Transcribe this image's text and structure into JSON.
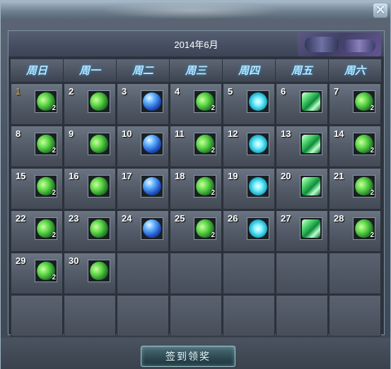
{
  "window": {
    "title": "",
    "close_glyph": "✕"
  },
  "calendar": {
    "month_title": "2014年6月",
    "weekdays": [
      "周日",
      "周一",
      "周二",
      "周三",
      "周四",
      "周五",
      "周六"
    ],
    "today": 1,
    "days": [
      {
        "day": 1,
        "item": "green-leaf-gem",
        "qty": "2"
      },
      {
        "day": 2,
        "item": "green-leaf-gem",
        "qty": ""
      },
      {
        "day": 3,
        "item": "blue-orb",
        "qty": ""
      },
      {
        "day": 4,
        "item": "green-leaf-gem",
        "qty": "2"
      },
      {
        "day": 5,
        "item": "cyan-orb",
        "qty": ""
      },
      {
        "day": 6,
        "item": "green-crystal",
        "qty": ""
      },
      {
        "day": 7,
        "item": "green-leaf-gem",
        "qty": "2"
      },
      {
        "day": 8,
        "item": "green-leaf-gem",
        "qty": "2"
      },
      {
        "day": 9,
        "item": "green-leaf-gem",
        "qty": ""
      },
      {
        "day": 10,
        "item": "blue-orb",
        "qty": ""
      },
      {
        "day": 11,
        "item": "green-leaf-gem",
        "qty": "2"
      },
      {
        "day": 12,
        "item": "cyan-orb",
        "qty": ""
      },
      {
        "day": 13,
        "item": "green-crystal",
        "qty": ""
      },
      {
        "day": 14,
        "item": "green-leaf-gem",
        "qty": "2"
      },
      {
        "day": 15,
        "item": "green-leaf-gem",
        "qty": "2"
      },
      {
        "day": 16,
        "item": "green-leaf-gem",
        "qty": ""
      },
      {
        "day": 17,
        "item": "blue-orb",
        "qty": ""
      },
      {
        "day": 18,
        "item": "green-leaf-gem",
        "qty": "2"
      },
      {
        "day": 19,
        "item": "cyan-orb",
        "qty": ""
      },
      {
        "day": 20,
        "item": "green-crystal",
        "qty": ""
      },
      {
        "day": 21,
        "item": "green-leaf-gem",
        "qty": "2"
      },
      {
        "day": 22,
        "item": "green-leaf-gem",
        "qty": "2"
      },
      {
        "day": 23,
        "item": "green-leaf-gem",
        "qty": ""
      },
      {
        "day": 24,
        "item": "blue-orb",
        "qty": ""
      },
      {
        "day": 25,
        "item": "green-leaf-gem",
        "qty": "2"
      },
      {
        "day": 26,
        "item": "cyan-orb",
        "qty": ""
      },
      {
        "day": 27,
        "item": "green-crystal",
        "qty": ""
      },
      {
        "day": 28,
        "item": "green-leaf-gem",
        "qty": "2"
      },
      {
        "day": 29,
        "item": "green-leaf-gem",
        "qty": "2"
      },
      {
        "day": 30,
        "item": "green-leaf-gem",
        "qty": ""
      }
    ],
    "total_cells": 42
  },
  "footer": {
    "signin_button_label": "签到领奖"
  },
  "colors": {
    "weekday_text": "#b7e6ff",
    "today_number": "#d9b05f",
    "day_number": "#ffffff"
  }
}
